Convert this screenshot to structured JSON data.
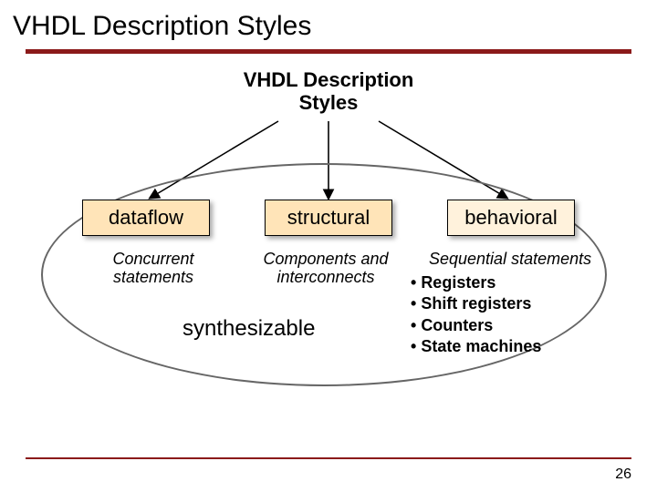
{
  "title": "VHDL Description Styles",
  "diagram": {
    "root": "VHDL Description\nStyles",
    "nodes": {
      "dataflow": {
        "label": "dataflow",
        "sub": "Concurrent statements"
      },
      "structural": {
        "label": "structural",
        "sub": "Components and interconnects"
      },
      "behavioral": {
        "label": "behavioral",
        "sub": "Sequential statements"
      }
    },
    "synthesizable_label": "synthesizable",
    "behavioral_bullets": [
      "Registers",
      "Shift registers",
      "Counters",
      "State machines"
    ]
  },
  "page_number": "26",
  "colors": {
    "accent": "#8b1a1a",
    "node_fill": "#ffe4b8",
    "node_fill_light": "#fff2dc"
  }
}
